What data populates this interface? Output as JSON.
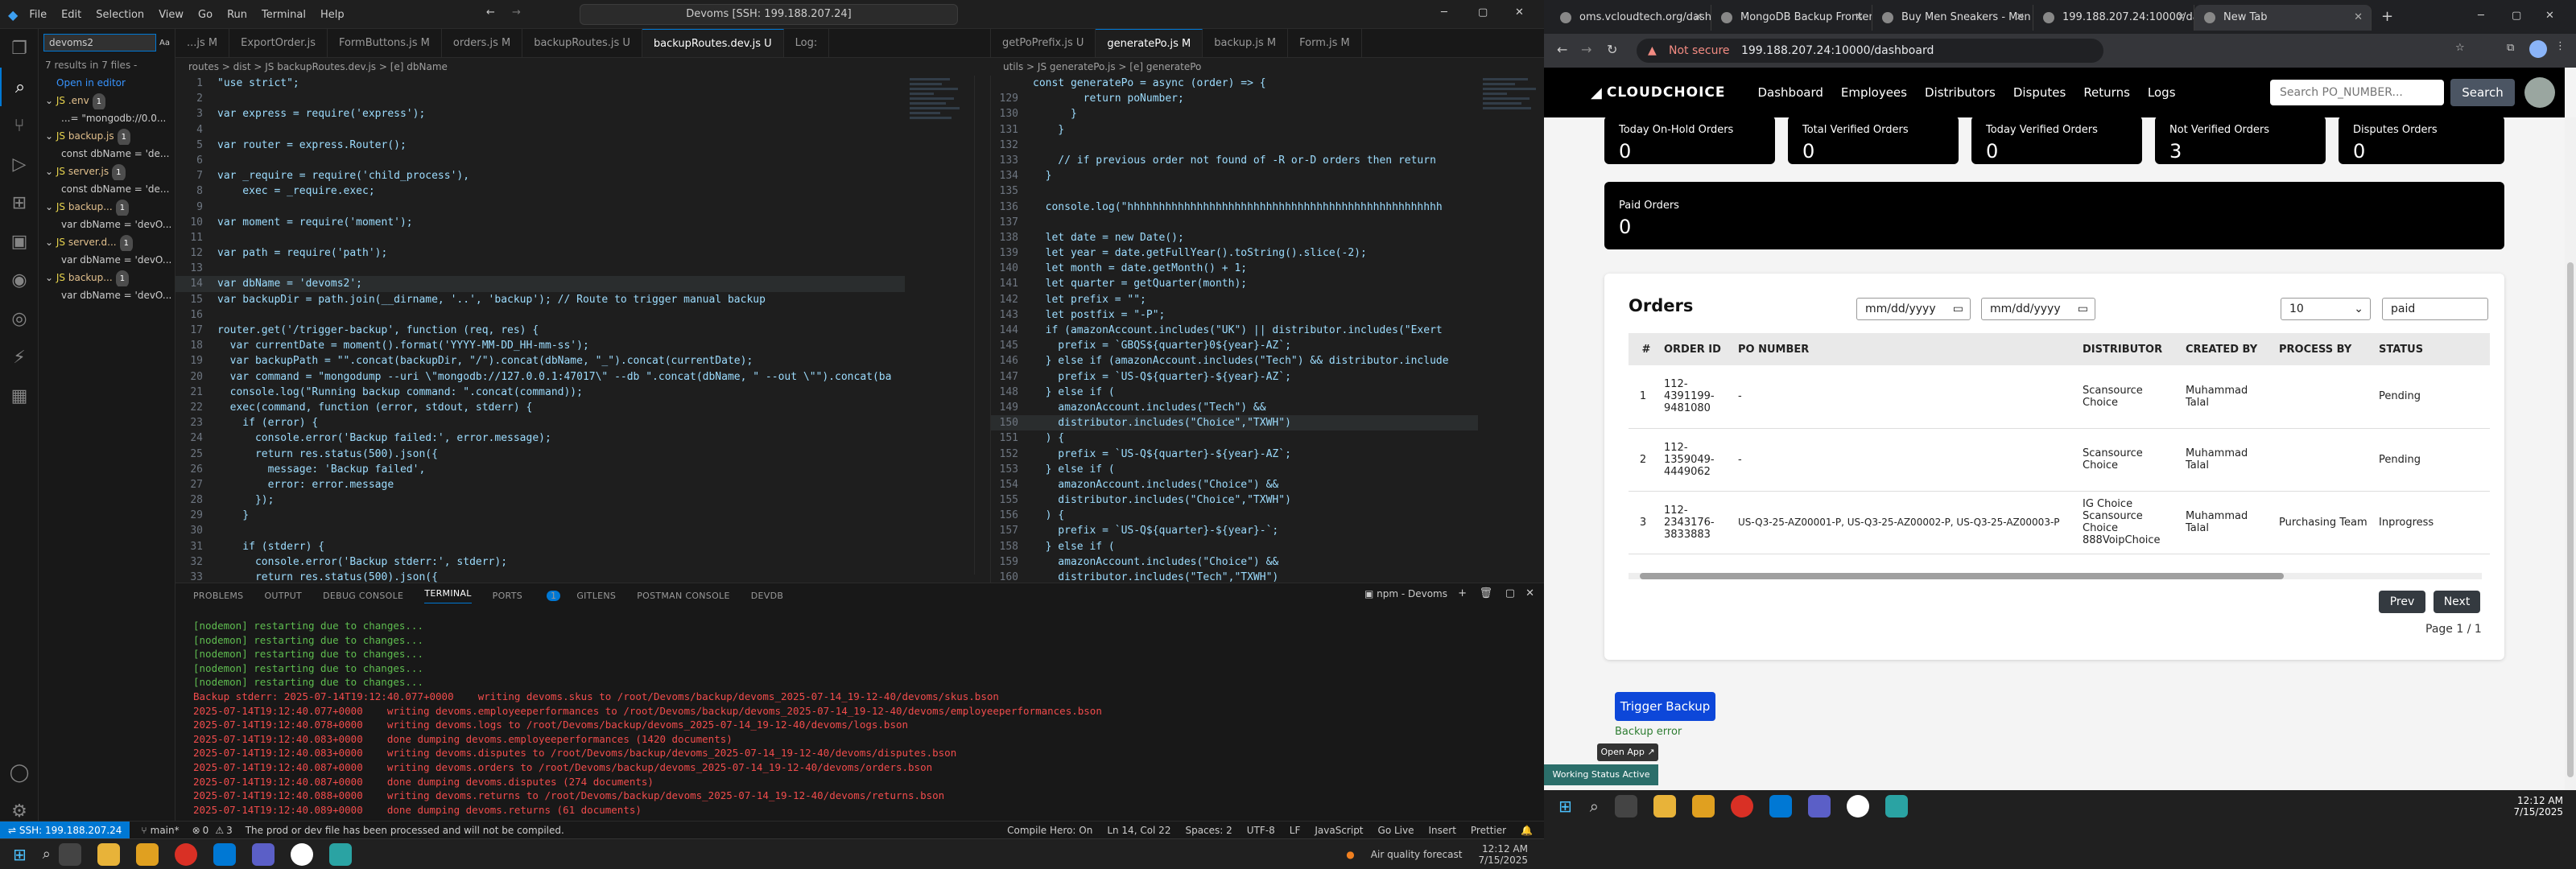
{
  "vscode": {
    "menu": [
      "File",
      "Edit",
      "Selection",
      "View",
      "Go",
      "Run",
      "Terminal",
      "Help"
    ],
    "command_center": "Devoms [SSH: 199.188.207.24]",
    "search": {
      "query": "devoms2",
      "summary": "7 results in 7 files -",
      "open_in_editor": "Open in editor",
      "results": [
        {
          "file": ".env",
          "badge": "1",
          "match": "...= \"mongodb://0.0..."
        },
        {
          "file": "backup.js",
          "badge": "1",
          "match": "const dbName = 'de..."
        },
        {
          "file": "server.js",
          "badge": "1",
          "match": "const dbName = 'de..."
        },
        {
          "file": "backup...",
          "badge": "1",
          "match": "var dbName = 'devO..."
        },
        {
          "file": "server.d...",
          "badge": "1",
          "match": "var dbName = 'devO..."
        },
        {
          "file": "backup...",
          "badge": "1",
          "match": "var dbName = 'devO..."
        }
      ]
    },
    "left_tabs": [
      {
        "label": "...js M",
        "active": false
      },
      {
        "label": "ExportOrder.js",
        "active": false
      },
      {
        "label": "FormButtons.js M",
        "active": false
      },
      {
        "label": "orders.js M",
        "active": false
      },
      {
        "label": "backupRoutes.js U",
        "active": false
      },
      {
        "label": "backupRoutes.dev.js U",
        "active": true
      },
      {
        "label": "Log:",
        "active": false
      }
    ],
    "left_breadcrumb": "routes > dist > JS backupRoutes.dev.js > [e] dbName",
    "left_code": [
      {
        "n": "1",
        "t": "\"use strict\";"
      },
      {
        "n": "2",
        "t": ""
      },
      {
        "n": "3",
        "t": "var express = require('express');"
      },
      {
        "n": "4",
        "t": ""
      },
      {
        "n": "5",
        "t": "var router = express.Router();"
      },
      {
        "n": "6",
        "t": ""
      },
      {
        "n": "7",
        "t": "var _require = require('child_process'),"
      },
      {
        "n": "8",
        "t": "    exec = _require.exec;"
      },
      {
        "n": "9",
        "t": ""
      },
      {
        "n": "10",
        "t": "var moment = require('moment');"
      },
      {
        "n": "11",
        "t": ""
      },
      {
        "n": "12",
        "t": "var path = require('path');"
      },
      {
        "n": "13",
        "t": ""
      },
      {
        "n": "14",
        "t": "var dbName = 'devoms2';"
      },
      {
        "n": "15",
        "t": "var backupDir = path.join(__dirname, '..', 'backup'); // Route to trigger manual backup"
      },
      {
        "n": "16",
        "t": ""
      },
      {
        "n": "17",
        "t": "router.get('/trigger-backup', function (req, res) {"
      },
      {
        "n": "18",
        "t": "  var currentDate = moment().format('YYYY-MM-DD_HH-mm-ss');"
      },
      {
        "n": "19",
        "t": "  var backupPath = \"\".concat(backupDir, \"/\").concat(dbName, \"_\").concat(currentDate);"
      },
      {
        "n": "20",
        "t": "  var command = \"mongodump --uri \\\"mongodb://127.0.0.1:47017\\\" --db \".concat(dbName, \" --out \\\"\").concat(ba"
      },
      {
        "n": "21",
        "t": "  console.log(\"Running backup command: \".concat(command));"
      },
      {
        "n": "22",
        "t": "  exec(command, function (error, stdout, stderr) {"
      },
      {
        "n": "23",
        "t": "    if (error) {"
      },
      {
        "n": "24",
        "t": "      console.error('Backup failed:', error.message);"
      },
      {
        "n": "25",
        "t": "      return res.status(500).json({"
      },
      {
        "n": "26",
        "t": "        message: 'Backup failed',"
      },
      {
        "n": "27",
        "t": "        error: error.message"
      },
      {
        "n": "28",
        "t": "      });"
      },
      {
        "n": "29",
        "t": "    }"
      },
      {
        "n": "30",
        "t": ""
      },
      {
        "n": "31",
        "t": "    if (stderr) {"
      },
      {
        "n": "32",
        "t": "      console.error('Backup stderr:', stderr);"
      },
      {
        "n": "33",
        "t": "      return res.status(500).json({"
      }
    ],
    "right_tabs": [
      {
        "label": "getPoPrefix.js U",
        "active": false
      },
      {
        "label": "generatePo.js M",
        "active": true
      },
      {
        "label": "backup.js M",
        "active": false
      },
      {
        "label": "Form.js M",
        "active": false
      }
    ],
    "right_breadcrumb": "utils > JS generatePo.js > [e] generatePo",
    "right_code": [
      {
        "n": "",
        "t": "const generatePo = async (order) => {"
      },
      {
        "n": "129",
        "t": "        return poNumber;"
      },
      {
        "n": "130",
        "t": "      }"
      },
      {
        "n": "131",
        "t": "    }"
      },
      {
        "n": "132",
        "t": ""
      },
      {
        "n": "133",
        "t": "    // if previous order not found of -R or-D orders then return"
      },
      {
        "n": "134",
        "t": "  }"
      },
      {
        "n": "135",
        "t": ""
      },
      {
        "n": "136",
        "t": "  console.log(\"hhhhhhhhhhhhhhhhhhhhhhhhhhhhhhhhhhhhhhhhhhhhhhhhhh"
      },
      {
        "n": "137",
        "t": ""
      },
      {
        "n": "138",
        "t": "  let date = new Date();"
      },
      {
        "n": "139",
        "t": "  let year = date.getFullYear().toString().slice(-2);"
      },
      {
        "n": "140",
        "t": "  let month = date.getMonth() + 1;"
      },
      {
        "n": "141",
        "t": "  let quarter = getQuarter(month);"
      },
      {
        "n": "142",
        "t": "  let prefix = \"\";"
      },
      {
        "n": "143",
        "t": "  let postfix = \"-P\";"
      },
      {
        "n": "144",
        "t": "  if (amazonAccount.includes(\"UK\") || distributor.includes(\"Exert"
      },
      {
        "n": "145",
        "t": "    prefix = `GBQS${quarter}0${year}-AZ`;"
      },
      {
        "n": "146",
        "t": "  } else if (amazonAccount.includes(\"Tech\") && distributor.include"
      },
      {
        "n": "147",
        "t": "    prefix = `US-Q${quarter}-${year}-AZ`;"
      },
      {
        "n": "148",
        "t": "  } else if ("
      },
      {
        "n": "149",
        "t": "    amazonAccount.includes(\"Tech\") &&"
      },
      {
        "n": "150",
        "t": "    distributor.includes(\"Choice\",\"TXWH\")"
      },
      {
        "n": "151",
        "t": "  ) {"
      },
      {
        "n": "152",
        "t": "    prefix = `US-Q${quarter}-${year}-AZ`;"
      },
      {
        "n": "153",
        "t": "  } else if ("
      },
      {
        "n": "154",
        "t": "    amazonAccount.includes(\"Choice\") &&"
      },
      {
        "n": "155",
        "t": "    distributor.includes(\"Choice\",\"TXWH\")"
      },
      {
        "n": "156",
        "t": "  ) {"
      },
      {
        "n": "157",
        "t": "    prefix = `US-Q${quarter}-${year}-`;"
      },
      {
        "n": "158",
        "t": "  } else if ("
      },
      {
        "n": "159",
        "t": "    amazonAccount.includes(\"Choice\") &&"
      },
      {
        "n": "160",
        "t": "    distributor.includes(\"Tech\",\"TXWH\")"
      }
    ],
    "panel_tabs": [
      "PROBLEMS",
      "OUTPUT",
      "DEBUG CONSOLE",
      "TERMINAL",
      "PORTS",
      "GITLENS",
      "POSTMAN CONSOLE",
      "DEVDB"
    ],
    "ports_badge": "1",
    "terminal_name": "npm - Devoms",
    "terminal_lines": [
      {
        "c": "g",
        "t": "[nodemon] restarting due to changes..."
      },
      {
        "c": "g",
        "t": "[nodemon] restarting due to changes..."
      },
      {
        "c": "g",
        "t": "[nodemon] restarting due to changes..."
      },
      {
        "c": "g",
        "t": "[nodemon] restarting due to changes..."
      },
      {
        "c": "g",
        "t": "[nodemon] restarting due to changes..."
      },
      {
        "c": "r",
        "t": "Backup stderr: 2025-07-14T19:12:40.077+0000    writing devoms.skus to /root/Devoms/backup/devoms_2025-07-14_19-12-40/devoms/skus.bson"
      },
      {
        "c": "r",
        "t": "2025-07-14T19:12:40.077+0000    writing devoms.employeeperformances to /root/Devoms/backup/devoms_2025-07-14_19-12-40/devoms/employeeperformances.bson"
      },
      {
        "c": "r",
        "t": "2025-07-14T19:12:40.078+0000    writing devoms.logs to /root/Devoms/backup/devoms_2025-07-14_19-12-40/devoms/logs.bson"
      },
      {
        "c": "r",
        "t": "2025-07-14T19:12:40.083+0000    done dumping devoms.employeeperformances (1420 documents)"
      },
      {
        "c": "r",
        "t": "2025-07-14T19:12:40.083+0000    writing devoms.disputes to /root/Devoms/backup/devoms_2025-07-14_19-12-40/devoms/disputes.bson"
      },
      {
        "c": "r",
        "t": "2025-07-14T19:12:40.087+0000    writing devoms.orders to /root/Devoms/backup/devoms_2025-07-14_19-12-40/devoms/orders.bson"
      },
      {
        "c": "r",
        "t": "2025-07-14T19:12:40.087+0000    done dumping devoms.disputes (274 documents)"
      },
      {
        "c": "r",
        "t": "2025-07-14T19:12:40.088+0000    writing devoms.returns to /root/Devoms/backup/devoms_2025-07-14_19-12-40/devoms/returns.bson"
      },
      {
        "c": "r",
        "t": "2025-07-14T19:12:40.089+0000    done dumping devoms.returns (61 documents)"
      }
    ],
    "status": {
      "remote": "SSH: 199.188.207.24",
      "branch": "main*",
      "errors": "0",
      "warnings": "3",
      "message": "The prod or dev file has been processed and will not be compiled.",
      "compile": "Compile Hero: On",
      "position": "Ln 14, Col 22",
      "spaces": "Spaces: 2",
      "encoding": "UTF-8",
      "eol": "LF",
      "language": "JavaScript",
      "golive": "Go Live",
      "insert": "Insert",
      "prettier": "Prettier"
    },
    "taskbar": {
      "weather": "Air quality forecast",
      "time": "12:12 AM",
      "date": "7/15/2025"
    }
  },
  "chrome": {
    "tabs": [
      {
        "label": "oms.vcloudtech.org/dash",
        "active": false
      },
      {
        "label": "MongoDB Backup Frontend",
        "active": false
      },
      {
        "label": "Buy Men Sneakers - Men",
        "active": false
      },
      {
        "label": "199.188.207.24:10000/da",
        "active": false
      },
      {
        "label": "New Tab",
        "active": true
      }
    ],
    "not_secure": "Not secure",
    "url": "199.188.207.24:10000/dashboard",
    "app": {
      "brand": "CLOUDCHOICE",
      "nav": [
        "Dashboard",
        "Employees",
        "Distributors",
        "Disputes",
        "Returns",
        "Logs"
      ],
      "search_placeholder": "Search PO_NUMBER...",
      "search_button": "Search",
      "stats": [
        {
          "label": "Today On-Hold Orders",
          "value": "0"
        },
        {
          "label": "Total Verified Orders",
          "value": "0"
        },
        {
          "label": "Today Verified Orders",
          "value": "0"
        },
        {
          "label": "Not Verified Orders",
          "value": "3"
        },
        {
          "label": "Disputes Orders",
          "value": "0"
        }
      ],
      "paid": {
        "label": "Paid Orders",
        "value": "0"
      },
      "orders": {
        "title": "Orders",
        "date_placeholder": "mm/dd/yyyy",
        "page_size": "10",
        "status_filter": "paid",
        "columns": [
          "#",
          "ORDER ID",
          "PO NUMBER",
          "DISTRIBUTOR",
          "CREATED BY",
          "PROCESS BY",
          "STATUS"
        ],
        "rows": [
          {
            "num": "1",
            "order_id": "112-4391199-9481080",
            "po": "-",
            "distributor": "Scansource Choice",
            "created_by": "Muhammad Talal",
            "process_by": "",
            "status": "Pending"
          },
          {
            "num": "2",
            "order_id": "112-1359049-4449062",
            "po": "-",
            "distributor": "Scansource Choice",
            "created_by": "Muhammad Talal",
            "process_by": "",
            "status": "Pending"
          },
          {
            "num": "3",
            "order_id": "112-2343176-3833883",
            "po": "US-Q3-25-AZ00001-P, US-Q3-25-AZ00002-P, US-Q3-25-AZ00003-P",
            "distributor": "IG Choice Scansource Choice 888VoipChoice",
            "created_by": "Muhammad Talal",
            "process_by": "Purchasing Team",
            "status": "Inprogress"
          }
        ],
        "prev": "Prev",
        "next": "Next",
        "page_info": "Page 1 / 1"
      },
      "trigger_backup": "Trigger Backup",
      "backup_error": "Backup error",
      "open_app": "Open App ↗",
      "working_status": "Working Status Active"
    },
    "taskbar": {
      "time": "12:12 AM",
      "date": "7/15/2025"
    }
  }
}
